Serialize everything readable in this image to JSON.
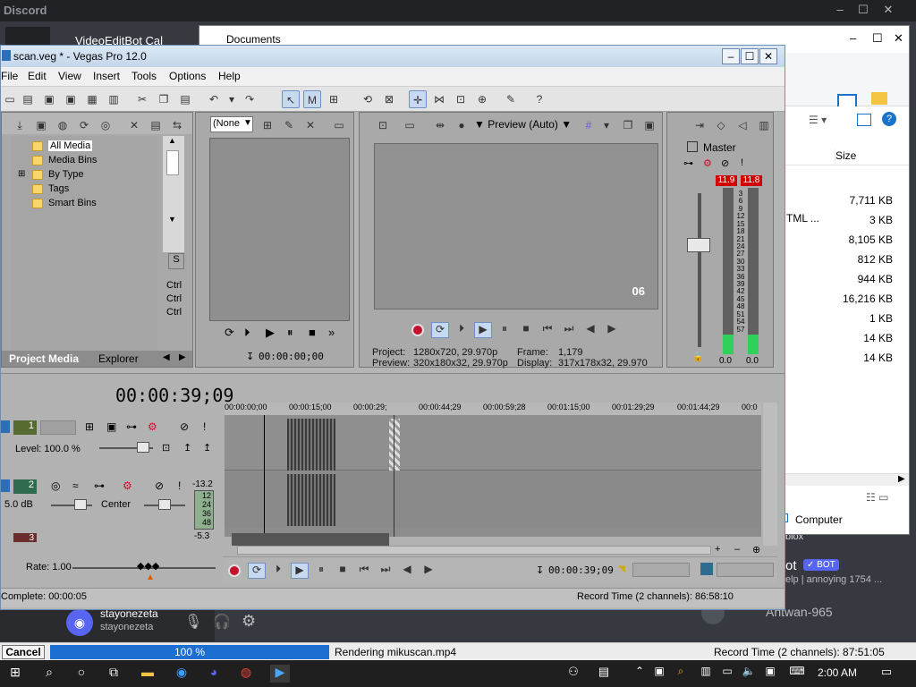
{
  "discord": {
    "title": "Discord",
    "user": "stayonezeta",
    "user_sub": "stayonezeta",
    "chat_partial": "VideoEditBot Cal",
    "bot_prefix": "ot",
    "bot_badge": "✓ BOT",
    "bot_line": "elp | annoying 1754 ...",
    "blox": "blox",
    "member": "Antwan-965"
  },
  "explorer": {
    "title": "Documents",
    "size_header": "Size",
    "sizes": [
      "7,711 KB",
      "3 KB",
      "8,105 KB",
      "812 KB",
      "944 KB",
      "16,216 KB",
      "1 KB",
      "14 KB",
      "14 KB"
    ],
    "html_label": "TML ...",
    "computer": "Computer"
  },
  "vegas": {
    "title": "scan.veg * - Vegas Pro 12.0",
    "menu": [
      "File",
      "Edit",
      "View",
      "Insert",
      "Tools",
      "Options",
      "Help"
    ],
    "project_media": {
      "tree": [
        "All Media",
        "Media Bins",
        "By Type",
        "Tags",
        "Smart Bins"
      ],
      "tabs": [
        "Project Media",
        "Explorer"
      ],
      "ctrl": [
        "Ctrl",
        "Ctrl",
        "Ctrl"
      ]
    },
    "trimmer": {
      "dropdown": "(None",
      "time": "00:00:00;00"
    },
    "preview": {
      "mode": "Preview (Auto)",
      "overlay": "06",
      "project": "Project:",
      "project_val": "1280x720, 29.970p",
      "preview": "Preview:",
      "preview_val": "320x180x32, 29.970p",
      "frame": "Frame:",
      "frame_val": "1,179",
      "display": "Display:",
      "display_val": "317x178x32, 29.970"
    },
    "mixer": {
      "master": "Master",
      "peak_l": "11.9",
      "peak_r": "11.8",
      "scale": [
        "3",
        "6",
        "9",
        "12",
        "15",
        "18",
        "21",
        "24",
        "27",
        "30",
        "33",
        "36",
        "39",
        "42",
        "45",
        "48",
        "51",
        "54",
        "57"
      ],
      "out_l": "0.0",
      "out_r": "0.0"
    },
    "timeline": {
      "time": "00:00:39;09",
      "ruler": [
        "00:00:00;00",
        "00:00:15;00",
        "00:00:29;",
        "00:00:44;29",
        "00:00:59;28",
        "00:01:15;00",
        "00:01:29;29",
        "00:01:44;29",
        "00:0"
      ],
      "track1_num": "1",
      "track1_level": "Level: 100.0 %",
      "track2_num": "2",
      "track2_db": "5.0 dB",
      "track2_pan": "Center",
      "track2_meter": "-13.2",
      "track2_meter_scale": [
        "12",
        "24",
        "36",
        "48"
      ],
      "track3_meter": "-5.3",
      "rate": "Rate: 1.00",
      "transport_time": "00:00:39;09",
      "complete": "Complete: 00:00:05",
      "record_time": "Record Time (2 channels): 86:58:10"
    }
  },
  "render": {
    "cancel": "Cancel",
    "progress": "100 %",
    "progress_value": 100,
    "file": "Rendering mikuscan.mp4",
    "record_time": "Record Time (2 channels): 87:51:05"
  },
  "taskbar": {
    "clock": "2:00 AM"
  }
}
